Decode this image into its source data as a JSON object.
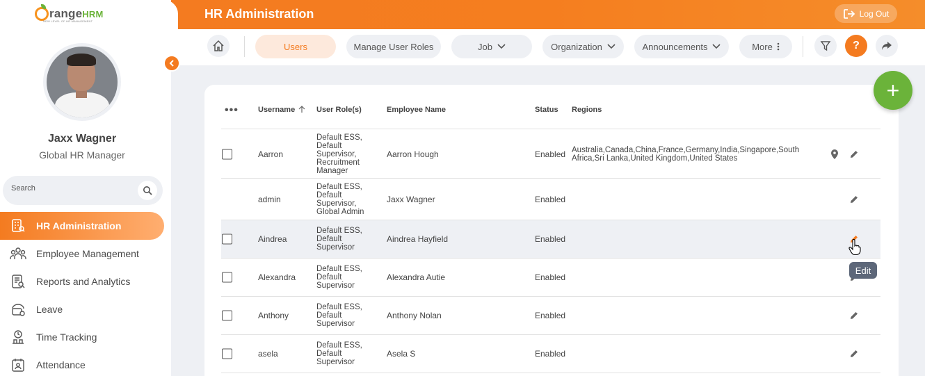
{
  "brand": {
    "name": "range",
    "suffix": "HRM",
    "tagline": "NEW LEVEL OF HR MANAGEMENT"
  },
  "header": {
    "title": "HR Administration",
    "logout_label": "Log Out"
  },
  "profile": {
    "name": "Jaxx Wagner",
    "role": "Global HR Manager"
  },
  "search": {
    "placeholder": "Search"
  },
  "sidebar": {
    "items": [
      {
        "label": "HR Administration",
        "icon": "hr-admin-icon",
        "active": true
      },
      {
        "label": "Employee Management",
        "icon": "people-icon"
      },
      {
        "label": "Reports and Analytics",
        "icon": "report-icon"
      },
      {
        "label": "Leave",
        "icon": "leave-icon"
      },
      {
        "label": "Time Tracking",
        "icon": "time-icon"
      },
      {
        "label": "Attendance",
        "icon": "attendance-icon"
      }
    ]
  },
  "tabs": {
    "users": "Users",
    "manage_roles": "Manage User Roles",
    "job": "Job",
    "organization": "Organization",
    "announcements": "Announcements",
    "more": "More"
  },
  "table": {
    "columns": {
      "username": "Username",
      "roles": "User Role(s)",
      "employee": "Employee Name",
      "status": "Status",
      "regions": "Regions"
    },
    "rows": [
      {
        "username": "Aarron",
        "roles": "Default ESS, Default Supervisor, Recruitment Manager",
        "employee": "Aarron Hough",
        "status": "Enabled",
        "regions": "Australia,Canada,China,France,Germany,India,Singapore,South Africa,Sri Lanka,United Kingdom,United States"
      },
      {
        "username": "admin",
        "roles": "Default ESS, Default Supervisor, Global Admin",
        "employee": "Jaxx Wagner",
        "status": "Enabled",
        "regions": ""
      },
      {
        "username": "Aindrea",
        "roles": "Default ESS, Default Supervisor",
        "employee": "Aindrea Hayfield",
        "status": "Enabled",
        "regions": ""
      },
      {
        "username": "Alexandra",
        "roles": "Default ESS, Default Supervisor",
        "employee": "Alexandra Autie",
        "status": "Enabled",
        "regions": ""
      },
      {
        "username": "Anthony",
        "roles": "Default ESS, Default Supervisor",
        "employee": "Anthony Nolan",
        "status": "Enabled",
        "regions": ""
      },
      {
        "username": "asela",
        "roles": "Default ESS, Default Supervisor",
        "employee": "Asela S",
        "status": "Enabled",
        "regions": ""
      }
    ]
  },
  "tooltip": {
    "edit": "Edit"
  },
  "colors": {
    "accent": "#f47b20",
    "fab": "#6bb33a",
    "tooltip": "#5d6779"
  }
}
